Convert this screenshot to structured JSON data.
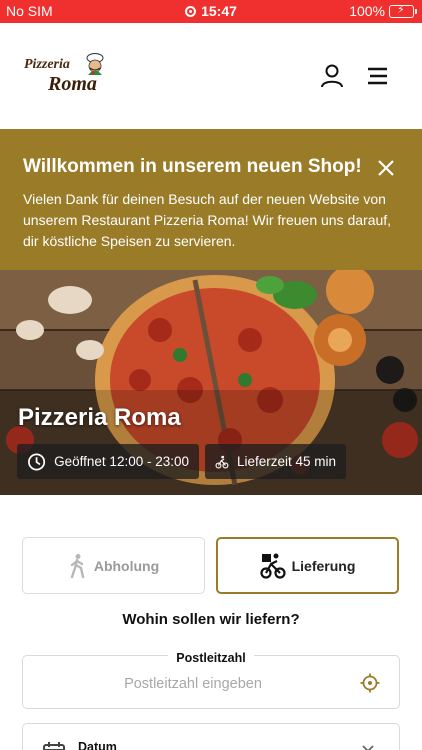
{
  "status_bar": {
    "carrier": "No SIM",
    "time": "15:47",
    "battery": "100%",
    "bar_color": "#f0302e"
  },
  "header": {
    "logo_line1": "Pizzeria",
    "logo_line2": "Roma",
    "icons": [
      "user-icon",
      "hamburger-menu-icon"
    ]
  },
  "banner": {
    "title": "Willkommen in unserem neuen Shop!",
    "text": "Vielen Dank für deinen Besuch auf der neuen Website von unserem Restaurant Pizzeria Roma! Wir freuen uns darauf, dir köstliche Speisen zu servieren.",
    "color": "#9a7c28"
  },
  "hero": {
    "restaurant_name": "Pizzeria Roma",
    "opening_hours": "Geöffnet 12:00 - 23:00",
    "delivery_time": "Lieferzeit 45 min"
  },
  "order_mode": {
    "pickup_label": "Abholung",
    "delivery_label": "Lieferung",
    "selected": "delivery",
    "question": "Wohin sollen wir liefern?"
  },
  "zip_field": {
    "label": "Postleitzahl",
    "placeholder": "Postleitzahl eingeben",
    "value": ""
  },
  "date_field": {
    "label": "Datum"
  },
  "accent_color": "#9a7c28"
}
